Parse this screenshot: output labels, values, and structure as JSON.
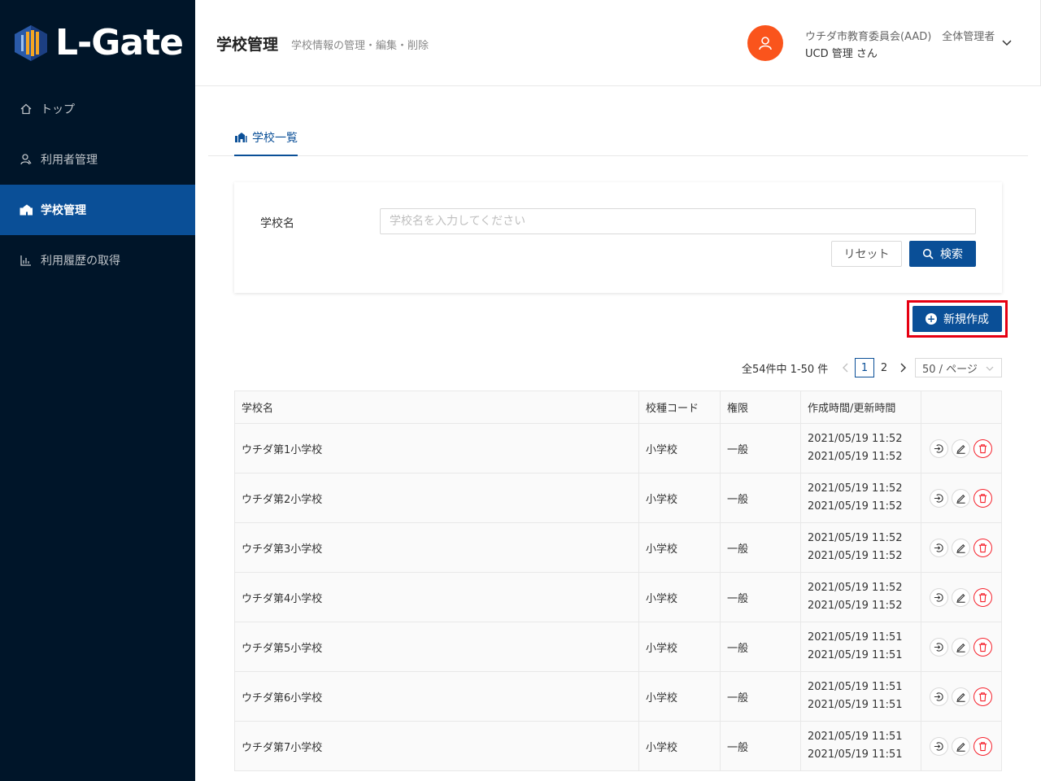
{
  "brand": {
    "name": "L-Gate"
  },
  "sidebar": {
    "items": [
      {
        "label": "トップ",
        "icon": "home-icon",
        "active": false
      },
      {
        "label": "利用者管理",
        "icon": "users-icon",
        "active": false
      },
      {
        "label": "学校管理",
        "icon": "school-icon",
        "active": true
      },
      {
        "label": "利用履歴の取得",
        "icon": "bar-chart-icon",
        "active": false
      }
    ]
  },
  "header": {
    "title": "学校管理",
    "subtitle": "学校情報の管理・編集・削除",
    "user_org": "ウチダ市教育委員会(AAD)　全体管理者",
    "user_name": "UCD 管理 さん"
  },
  "tabs": [
    {
      "label": "学校一覧"
    }
  ],
  "search": {
    "label": "学校名",
    "placeholder": "学校名を入力してください",
    "value": "",
    "reset_label": "リセット",
    "search_label": "検索"
  },
  "new_button_label": "新規作成",
  "pagination": {
    "total_text": "全54件中 1-50 件",
    "pages": [
      "1",
      "2"
    ],
    "current": "1",
    "page_size": "50 / ページ"
  },
  "table": {
    "columns": [
      "学校名",
      "校種コード",
      "権限",
      "作成時間/更新時間",
      ""
    ],
    "rows": [
      {
        "name": "ウチダ第1小学校",
        "type": "小学校",
        "role": "一般",
        "created": "2021/05/19 11:52",
        "updated": "2021/05/19 11:52"
      },
      {
        "name": "ウチダ第2小学校",
        "type": "小学校",
        "role": "一般",
        "created": "2021/05/19 11:52",
        "updated": "2021/05/19 11:52"
      },
      {
        "name": "ウチダ第3小学校",
        "type": "小学校",
        "role": "一般",
        "created": "2021/05/19 11:52",
        "updated": "2021/05/19 11:52"
      },
      {
        "name": "ウチダ第4小学校",
        "type": "小学校",
        "role": "一般",
        "created": "2021/05/19 11:52",
        "updated": "2021/05/19 11:52"
      },
      {
        "name": "ウチダ第5小学校",
        "type": "小学校",
        "role": "一般",
        "created": "2021/05/19 11:51",
        "updated": "2021/05/19 11:51"
      },
      {
        "name": "ウチダ第6小学校",
        "type": "小学校",
        "role": "一般",
        "created": "2021/05/19 11:51",
        "updated": "2021/05/19 11:51"
      },
      {
        "name": "ウチダ第7小学校",
        "type": "小学校",
        "role": "一般",
        "created": "2021/05/19 11:51",
        "updated": "2021/05/19 11:51"
      }
    ]
  },
  "colors": {
    "sidebar_bg": "#001529",
    "primary": "#0a4f97",
    "avatar": "#fa541c",
    "highlight_border": "#e60012",
    "danger": "#f5222d"
  }
}
